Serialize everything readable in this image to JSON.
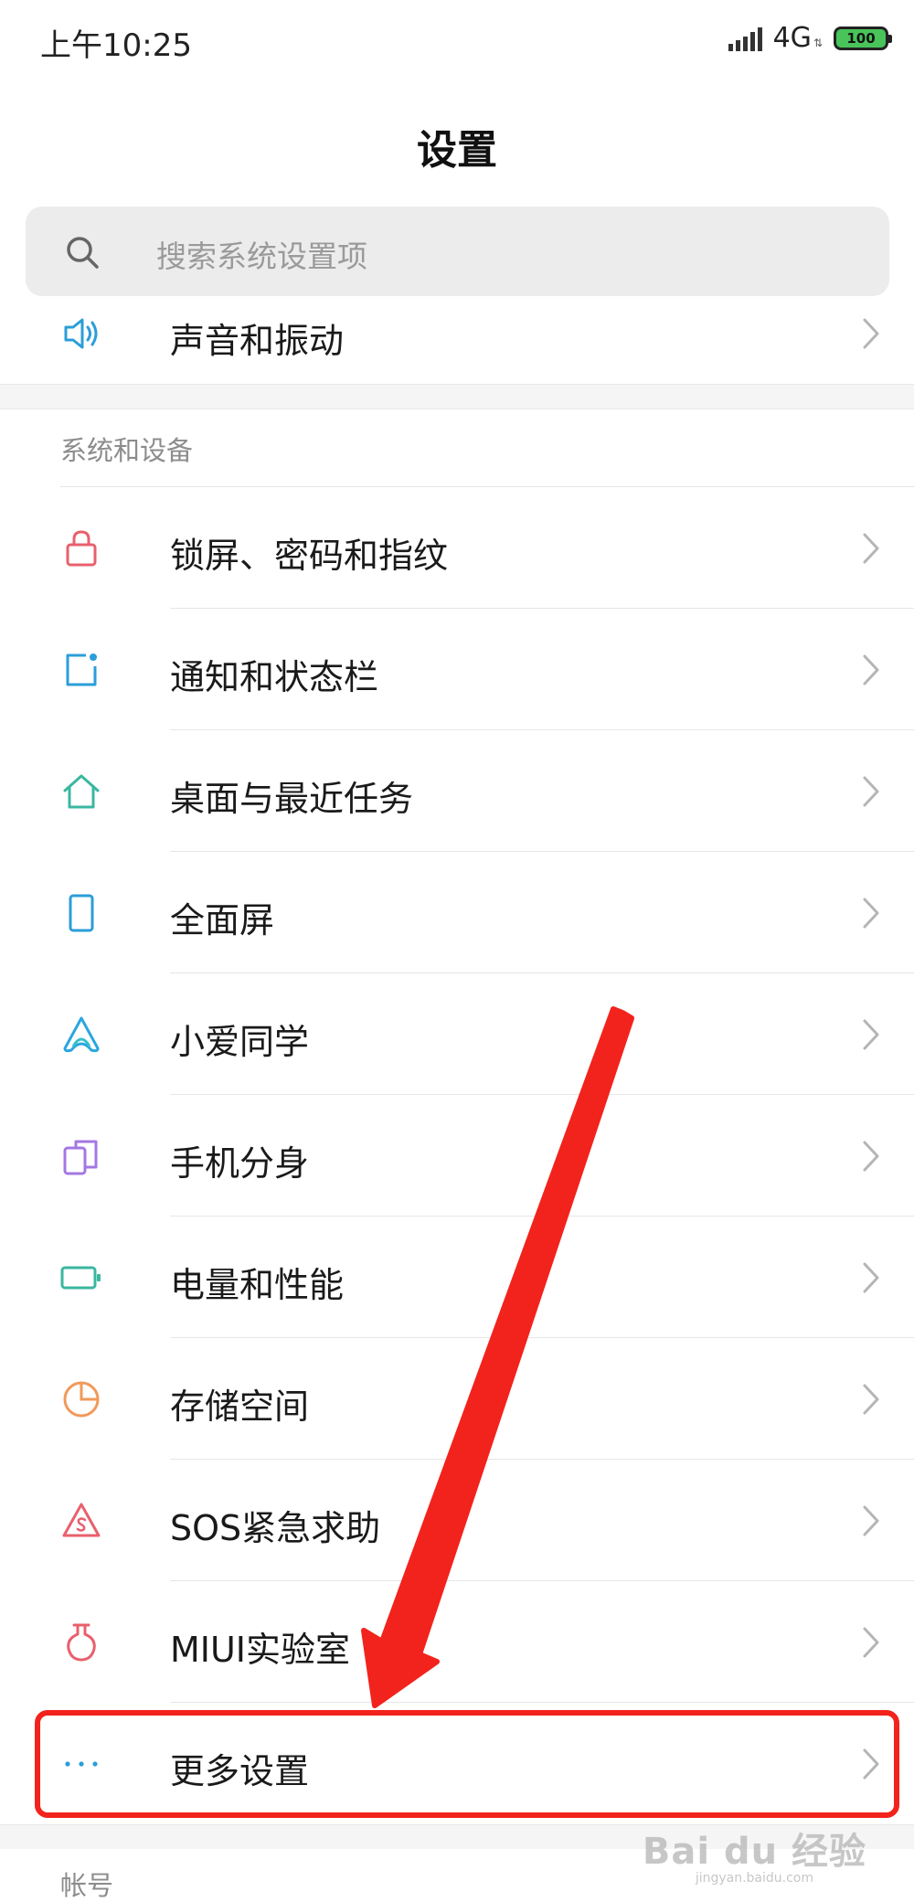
{
  "status_bar": {
    "time": "上午10:25",
    "network": "4G",
    "battery": "100"
  },
  "header": {
    "title": "设置"
  },
  "search": {
    "placeholder": "搜索系统设置项"
  },
  "partial_item": {
    "label": "声音和振动",
    "icon": "speaker-icon"
  },
  "section_system": {
    "header": "系统和设备",
    "items": [
      {
        "label": "锁屏、密码和指纹",
        "icon": "lock-icon",
        "color": "#e8606d"
      },
      {
        "label": "通知和状态栏",
        "icon": "notification-icon",
        "color": "#2b9ed8"
      },
      {
        "label": "桌面与最近任务",
        "icon": "home-icon",
        "color": "#39b7a0"
      },
      {
        "label": "全面屏",
        "icon": "phone-screen-icon",
        "color": "#2b9ed8"
      },
      {
        "label": "小爱同学",
        "icon": "xiaoai-icon",
        "color": "#2aa6e0"
      },
      {
        "label": "手机分身",
        "icon": "dual-phone-icon",
        "color": "#a477e3"
      },
      {
        "label": "电量和性能",
        "icon": "battery-icon",
        "color": "#39b7a0"
      },
      {
        "label": "存储空间",
        "icon": "storage-pie-icon",
        "color": "#f09a5a"
      },
      {
        "label": "SOS紧急求助",
        "icon": "sos-icon",
        "color": "#e8606d"
      },
      {
        "label": "MIUI实验室",
        "icon": "flask-icon",
        "color": "#e8606d"
      },
      {
        "label": "更多设置",
        "icon": "more-dots-icon",
        "color": "#2b9ed8"
      }
    ]
  },
  "section_account": {
    "header": "帐号"
  },
  "annotation": {
    "highlight_color": "#f2231c"
  },
  "watermark": {
    "main": "Bai du 经验",
    "sub": "jingyan.baidu.com"
  }
}
